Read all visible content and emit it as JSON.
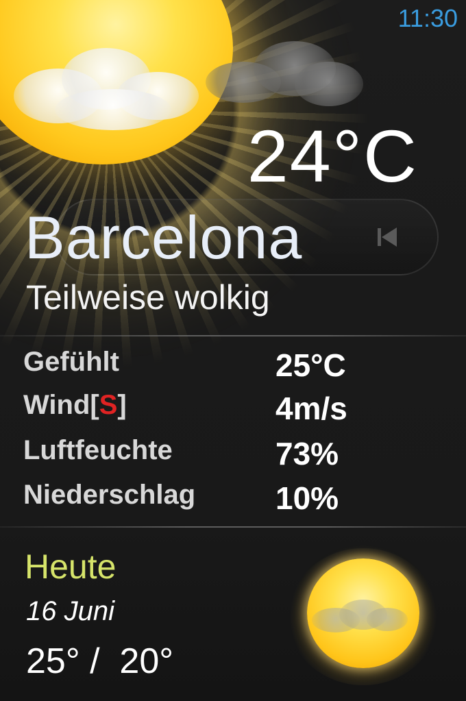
{
  "clock": "11:30",
  "current": {
    "temperature": "24°C",
    "city": "Barcelona",
    "condition": "Teilweise wolkig"
  },
  "stats": {
    "felt_label": "Gefühlt",
    "felt_value": "25°C",
    "wind_label": "Wind",
    "wind_bracket_open": "[",
    "wind_direction": "S",
    "wind_bracket_close": "]",
    "wind_value": "4m/s",
    "humidity_label": "Luftfeuchte",
    "humidity_value": "73%",
    "precip_label": "Niederschlag",
    "precip_value": "10%"
  },
  "today": {
    "title": "Heute",
    "date": "16 Juni",
    "range": "25° /  20°"
  },
  "icons": {
    "current_weather": "partly-cloudy-sun-icon",
    "forecast_weather": "partly-cloudy-sun-icon",
    "previous": "skip-previous-icon"
  },
  "colors": {
    "background": "#1a1a1a",
    "clock": "#3a9de0",
    "heute": "#d6e46a",
    "wind_direction": "#e02323"
  }
}
